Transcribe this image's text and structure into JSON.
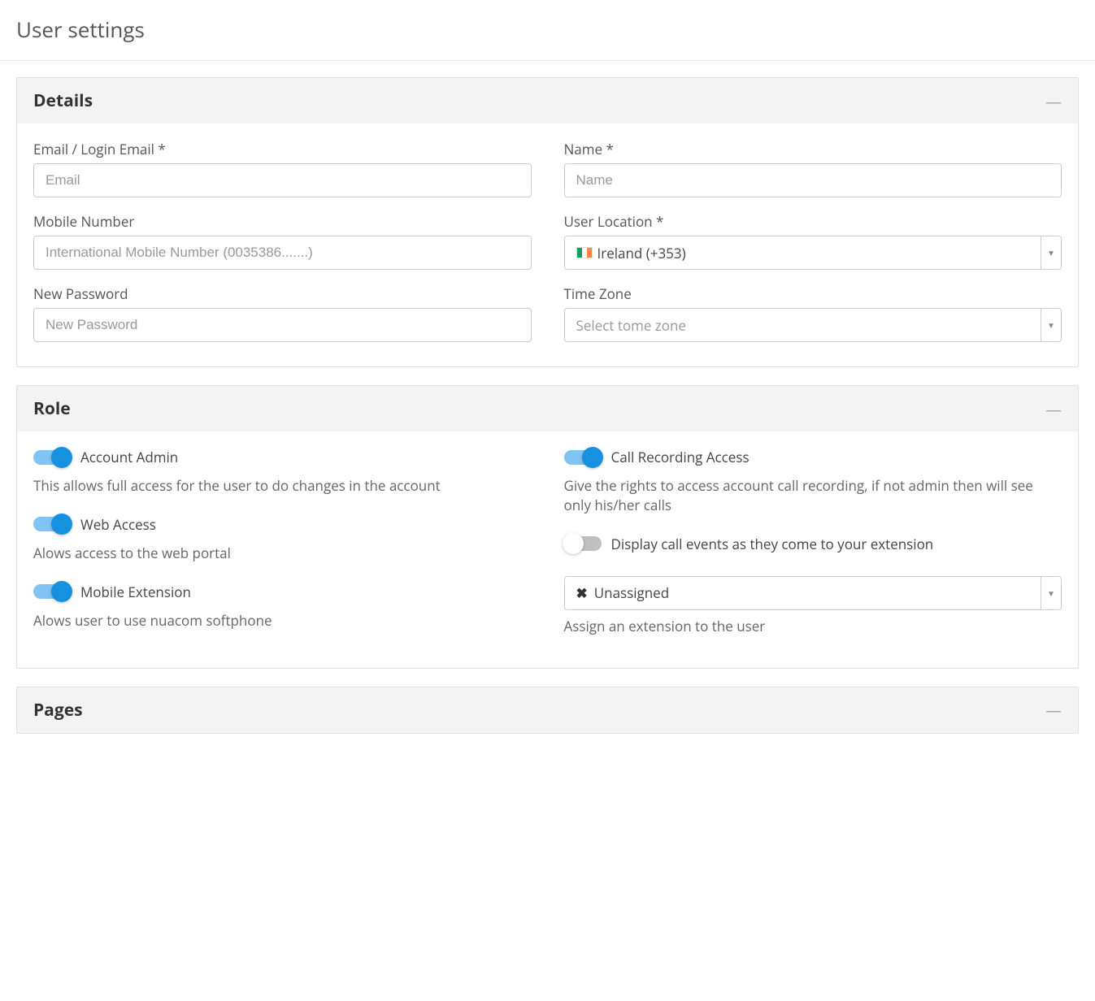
{
  "page": {
    "title": "User settings"
  },
  "panels": {
    "details": {
      "title": "Details",
      "fields": {
        "email": {
          "label": "Email / Login Email *",
          "placeholder": "Email",
          "value": ""
        },
        "name": {
          "label": "Name *",
          "placeholder": "Name",
          "value": ""
        },
        "mobile": {
          "label": "Mobile Number",
          "placeholder": "International Mobile Number (0035386.......)",
          "value": ""
        },
        "location": {
          "label": "User Location *",
          "value": "Ireland (+353)",
          "flag": "ie"
        },
        "password": {
          "label": "New Password",
          "placeholder": "New Password",
          "value": ""
        },
        "timezone": {
          "label": "Time Zone",
          "placeholder": "Select tome zone",
          "value": ""
        }
      }
    },
    "role": {
      "title": "Role",
      "toggles": {
        "account_admin": {
          "label": "Account Admin",
          "on": true,
          "help": "This allows full access for the user to do changes in the account"
        },
        "call_recording": {
          "label": "Call Recording Access",
          "on": true,
          "help": "Give the rights to access account call recording, if not admin then will see only his/her calls"
        },
        "web_access": {
          "label": "Web Access",
          "on": true,
          "help": "Alows access to the web portal"
        },
        "display_events": {
          "label": "Display call events as they come to your extension",
          "on": false
        },
        "mobile_ext": {
          "label": "Mobile Extension",
          "on": true,
          "help": "Alows user to use nuacom softphone"
        }
      },
      "extension": {
        "value": "Unassigned",
        "help": "Assign an extension to the user"
      }
    },
    "pages": {
      "title": "Pages"
    }
  }
}
